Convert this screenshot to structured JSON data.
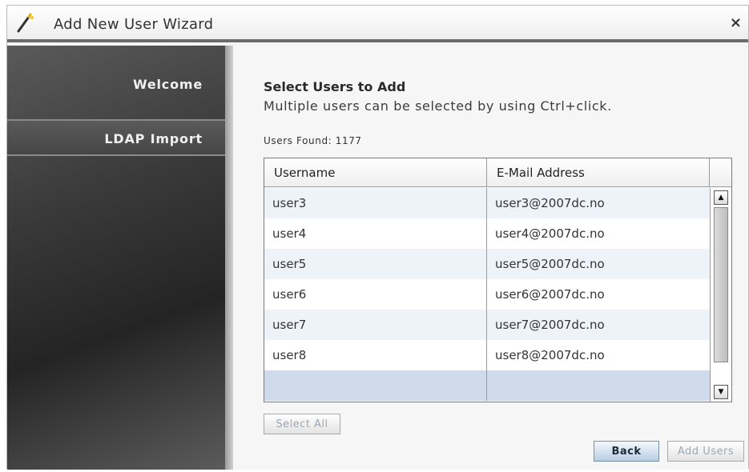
{
  "window": {
    "title": "Add New User Wizard",
    "close_glyph": "×"
  },
  "sidebar": {
    "items": [
      {
        "label": "Welcome",
        "active": false
      },
      {
        "label": "LDAP Import",
        "active": true
      }
    ]
  },
  "main": {
    "title": "Select Users to Add",
    "subtitle": "Multiple users can be selected by using Ctrl+click.",
    "users_found": "Users Found: 1177"
  },
  "table": {
    "columns": [
      "Username",
      "E-Mail Address"
    ],
    "rows": [
      {
        "username": "user3",
        "email": "user3@2007dc.no"
      },
      {
        "username": "user4",
        "email": "user4@2007dc.no"
      },
      {
        "username": "user5",
        "email": "user5@2007dc.no"
      },
      {
        "username": "user6",
        "email": "user6@2007dc.no"
      },
      {
        "username": "user7",
        "email": "user7@2007dc.no"
      },
      {
        "username": "user8",
        "email": "user8@2007dc.no"
      },
      {
        "username": "",
        "email": ""
      }
    ],
    "scroll_up_glyph": "▲",
    "scroll_down_glyph": "▼"
  },
  "buttons": {
    "select_all": "Select All",
    "back": "Back",
    "add_users": "Add Users"
  },
  "colors": {
    "row_alt": "#eef3fa",
    "row_selected": "#cfdbeb",
    "sidebar_dark": "#242424"
  }
}
